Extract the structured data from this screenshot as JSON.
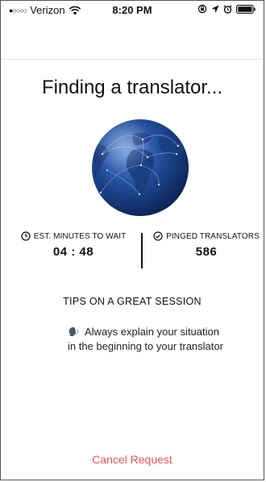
{
  "status_bar": {
    "signal": "●○○○○",
    "carrier": "Verizon",
    "time": "8:20 PM",
    "icons": [
      "wifi-icon",
      "orientation-lock-icon",
      "location-icon",
      "alarm-icon",
      "battery-icon"
    ]
  },
  "screen": {
    "title": "Finding a translator..."
  },
  "stats": {
    "wait_label": "EST. MINUTES TO WAIT",
    "wait_value": "04 : 48",
    "pinged_label": "PINGED TRANSLATORS",
    "pinged_value": "586"
  },
  "tips": {
    "heading": "TIPS ON A GREAT SESSION",
    "tip_text": "Always explain your situation in the beginning to your translator"
  },
  "actions": {
    "cancel_label": "Cancel Request"
  },
  "colors": {
    "accent_cancel": "#e8535b",
    "globe_deep": "#0e2a66",
    "globe_light": "#3f6fc4"
  }
}
